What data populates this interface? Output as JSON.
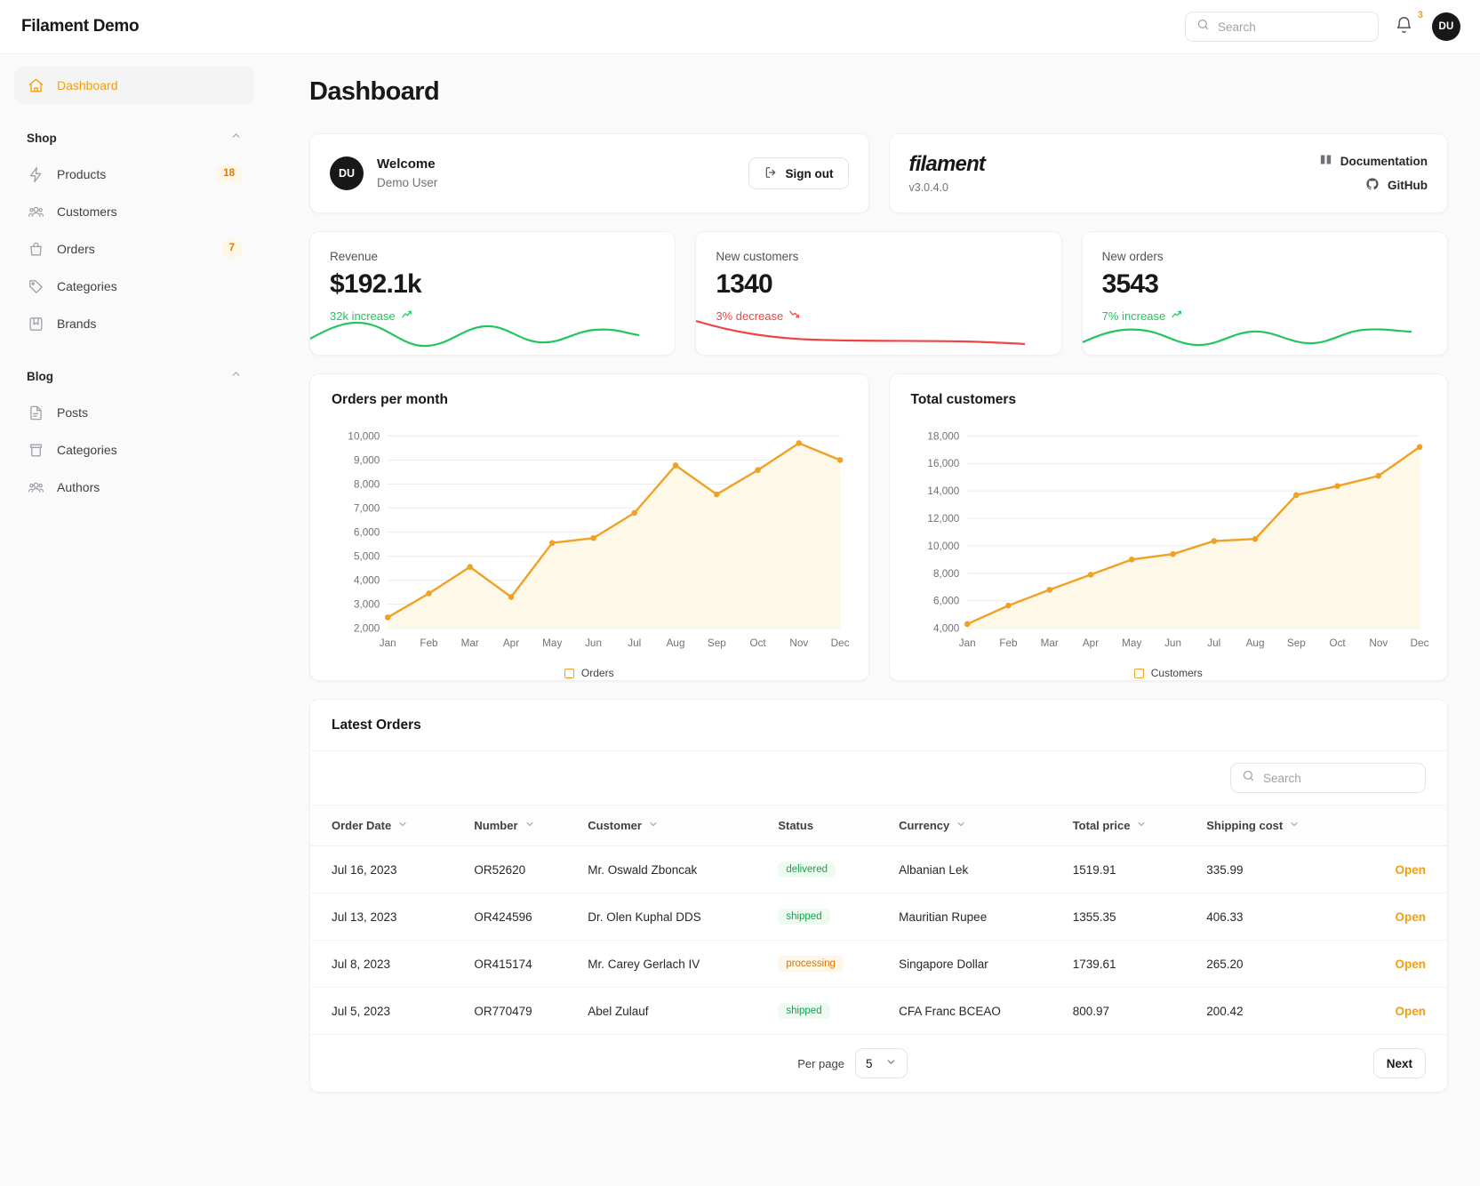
{
  "topbar": {
    "brand": "Filament Demo",
    "search_placeholder": "Search",
    "notification_count": "3",
    "avatar_initials": "DU"
  },
  "sidebar": {
    "dashboard_label": "Dashboard",
    "groups": [
      {
        "label": "Shop",
        "items": [
          {
            "label": "Products",
            "count": "18",
            "icon": "bolt-icon"
          },
          {
            "label": "Customers",
            "count": "",
            "icon": "users-icon"
          },
          {
            "label": "Orders",
            "count": "7",
            "icon": "bag-icon"
          },
          {
            "label": "Categories",
            "count": "",
            "icon": "tag-icon"
          },
          {
            "label": "Brands",
            "count": "",
            "icon": "bookmark-icon"
          }
        ]
      },
      {
        "label": "Blog",
        "items": [
          {
            "label": "Posts",
            "count": "",
            "icon": "document-icon"
          },
          {
            "label": "Categories",
            "count": "",
            "icon": "archive-icon"
          },
          {
            "label": "Authors",
            "count": "",
            "icon": "users-icon"
          }
        ]
      }
    ]
  },
  "page": {
    "title": "Dashboard"
  },
  "welcome": {
    "avatar_initials": "DU",
    "title": "Welcome",
    "subtitle": "Demo User",
    "signout_label": "Sign out"
  },
  "filament": {
    "logo": "filament",
    "version": "v3.0.4.0",
    "documentation_label": "Documentation",
    "github_label": "GitHub"
  },
  "stats": [
    {
      "label": "Revenue",
      "value": "$192.1k",
      "delta": "32k increase",
      "direction": "up",
      "color": "#22c55e"
    },
    {
      "label": "New customers",
      "value": "1340",
      "delta": "3% decrease",
      "direction": "down",
      "color": "#ef4444"
    },
    {
      "label": "New orders",
      "value": "3543",
      "delta": "7% increase",
      "direction": "up",
      "color": "#22c55e"
    }
  ],
  "chart_data": [
    {
      "type": "area",
      "title": "Orders per month",
      "categories": [
        "Jan",
        "Feb",
        "Mar",
        "Apr",
        "May",
        "Jun",
        "Jul",
        "Aug",
        "Sep",
        "Oct",
        "Nov",
        "Dec"
      ],
      "series": [
        {
          "name": "Orders",
          "values": [
            2450,
            3450,
            4550,
            3300,
            5550,
            5750,
            6800,
            8780,
            7570,
            8580,
            9700,
            9000
          ]
        }
      ],
      "ylim": [
        2000,
        10000
      ],
      "yticks": [
        2000,
        3000,
        4000,
        5000,
        6000,
        7000,
        8000,
        9000,
        10000
      ],
      "ytick_labels": [
        "2,000",
        "3,000",
        "4,000",
        "5,000",
        "6,000",
        "7,000",
        "8,000",
        "9,000",
        "10,000"
      ],
      "xlabel": "",
      "ylabel": "",
      "grid": true,
      "legend": "Orders",
      "legend_position": "bottom",
      "line_color": "#f0a022",
      "fill_color": "#fdf8e8"
    },
    {
      "type": "area",
      "title": "Total customers",
      "categories": [
        "Jan",
        "Feb",
        "Mar",
        "Apr",
        "May",
        "Jun",
        "Jul",
        "Aug",
        "Sep",
        "Oct",
        "Nov",
        "Dec"
      ],
      "series": [
        {
          "name": "Customers",
          "values": [
            4300,
            5650,
            6800,
            7900,
            9000,
            9400,
            10350,
            10500,
            13700,
            14350,
            15100,
            17200
          ]
        }
      ],
      "ylim": [
        4000,
        18000
      ],
      "yticks": [
        4000,
        6000,
        8000,
        10000,
        12000,
        14000,
        16000,
        18000
      ],
      "ytick_labels": [
        "4,000",
        "6,000",
        "8,000",
        "10,000",
        "12,000",
        "14,000",
        "16,000",
        "18,000"
      ],
      "xlabel": "",
      "ylabel": "",
      "grid": true,
      "legend": "Customers",
      "legend_position": "bottom",
      "line_color": "#f0a022",
      "fill_color": "#fdf8e8"
    }
  ],
  "orders_table": {
    "title": "Latest Orders",
    "search_placeholder": "Search",
    "columns": [
      "Order Date",
      "Number",
      "Customer",
      "Status",
      "Currency",
      "Total price",
      "Shipping cost",
      ""
    ],
    "sortable": [
      true,
      true,
      true,
      false,
      true,
      true,
      true,
      false
    ],
    "rows": [
      {
        "date": "Jul 16, 2023",
        "number": "OR52620",
        "customer": "Mr. Oswald Zboncak",
        "status": "delivered",
        "status_tone": "green",
        "currency": "Albanian Lek",
        "total": "1519.91",
        "shipping": "335.99",
        "action": "Open"
      },
      {
        "date": "Jul 13, 2023",
        "number": "OR424596",
        "customer": "Dr. Olen Kuphal DDS",
        "status": "shipped",
        "status_tone": "green",
        "currency": "Mauritian Rupee",
        "total": "1355.35",
        "shipping": "406.33",
        "action": "Open"
      },
      {
        "date": "Jul 8, 2023",
        "number": "OR415174",
        "customer": "Mr. Carey Gerlach IV",
        "status": "processing",
        "status_tone": "amber",
        "currency": "Singapore Dollar",
        "total": "1739.61",
        "shipping": "265.20",
        "action": "Open"
      },
      {
        "date": "Jul 5, 2023",
        "number": "OR770479",
        "customer": "Abel Zulauf",
        "status": "shipped",
        "status_tone": "green",
        "currency": "CFA Franc BCEAO",
        "total": "800.97",
        "shipping": "200.42",
        "action": "Open"
      }
    ],
    "per_page_label": "Per page",
    "per_page_value": "5",
    "next_label": "Next"
  }
}
